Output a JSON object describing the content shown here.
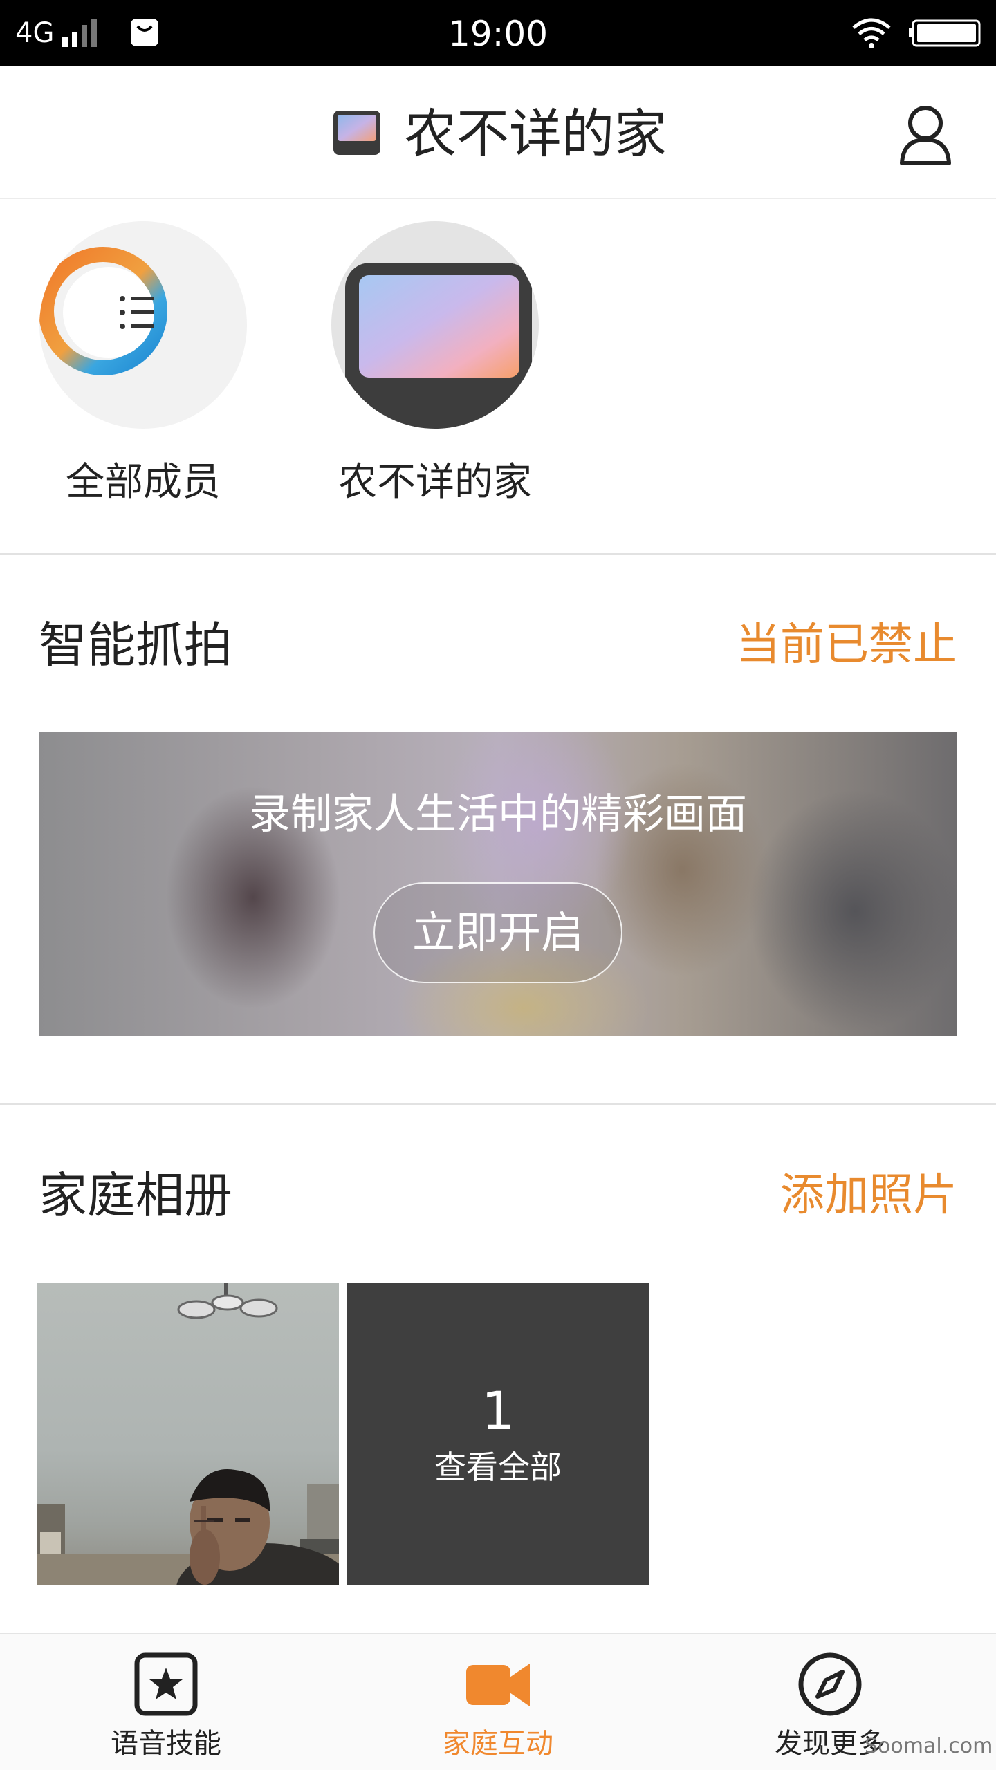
{
  "status_bar": {
    "network": "4G",
    "time": "19:00",
    "icons": [
      "signal-icon",
      "shopping-bag-icon",
      "wifi-icon",
      "battery-icon"
    ]
  },
  "header": {
    "title": "农不详的家",
    "icons": [
      "smart-display-icon",
      "profile-icon"
    ]
  },
  "members": [
    {
      "label": "全部成员",
      "icon": "all-members-ring-icon"
    },
    {
      "label": "农不详的家",
      "icon": "smart-display-device-icon"
    }
  ],
  "smart_capture": {
    "title": "智能抓拍",
    "status": "当前已禁止",
    "banner_text": "录制家人生活中的精彩画面",
    "button_label": "立即开启"
  },
  "album": {
    "title": "家庭相册",
    "action": "添加照片",
    "count": "1",
    "view_all": "查看全部"
  },
  "tabbar": {
    "items": [
      {
        "label": "语音技能",
        "icon": "star-icon"
      },
      {
        "label": "家庭互动",
        "icon": "video-camera-icon"
      },
      {
        "label": "发现更多",
        "icon": "compass-icon"
      }
    ]
  },
  "watermark": "Soomal.com",
  "colors": {
    "accent": "#f0882e",
    "action_text": "#e88a2e",
    "statusbar": "#000000",
    "tile_dark": "#3f3f3f"
  }
}
